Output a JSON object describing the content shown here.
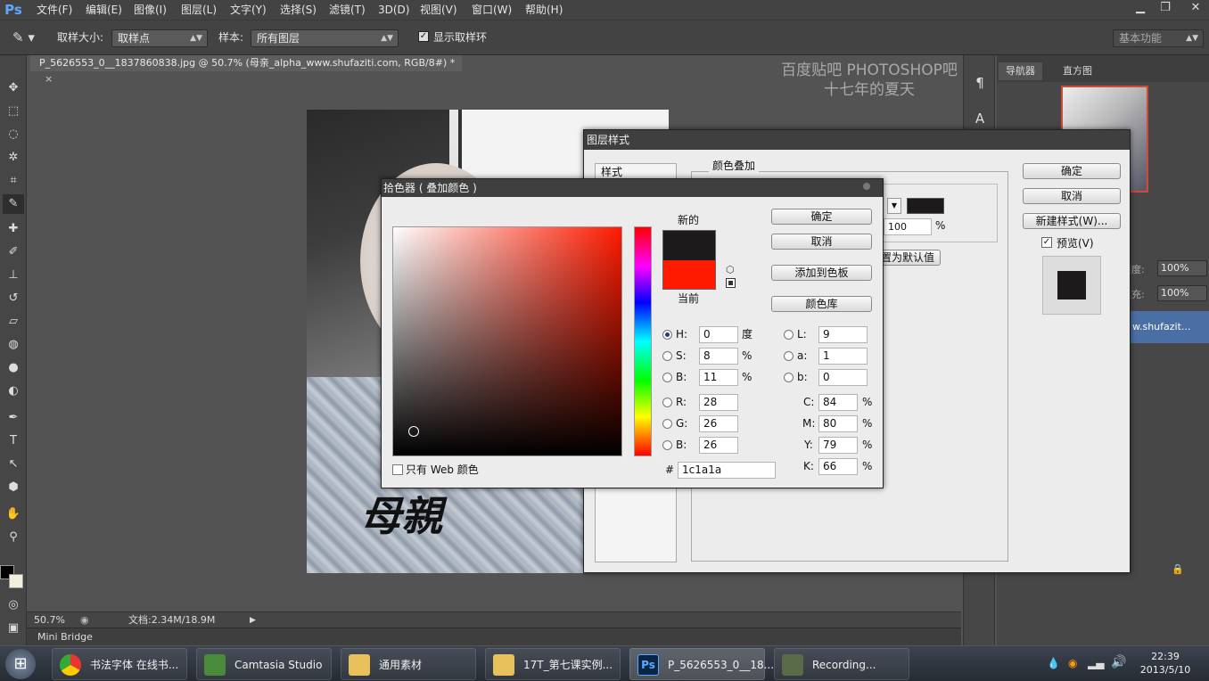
{
  "menubar": {
    "logo": "Ps",
    "items": [
      "文件(F)",
      "编辑(E)",
      "图像(I)",
      "图层(L)",
      "文字(Y)",
      "选择(S)",
      "滤镜(T)",
      "3D(D)",
      "视图(V)",
      "窗口(W)",
      "帮助(H)"
    ],
    "min": "▁",
    "restore": "❐",
    "close": "✕"
  },
  "options": {
    "sample_size_label": "取样大小:",
    "sample_size_value": "取样点",
    "sample_label": "样本:",
    "sample_value": "所有图层",
    "show_ring_label": "显示取样环",
    "workspace": "基本功能"
  },
  "document": {
    "tab_title": "P_5626553_0__1837860838.jpg @ 50.7% (母亲_alpha_www.shufaziti.com, RGB/8#) *",
    "close": "×",
    "calligraphy": "母親"
  },
  "watermark": {
    "line1": "百度贴吧 PHOTOSHOP吧",
    "line2": "十七年的夏天"
  },
  "right_panel": {
    "tab_navigator": "导航器",
    "tab_histogram": "直方图",
    "opacity_label": "明度:",
    "opacity_value": "100%",
    "fill_label": "填充:",
    "fill_value": "100%",
    "layer_name": "w.shufazit..."
  },
  "layer_style": {
    "title": "图层样式",
    "styles_header": "样式",
    "section_title": "颜色叠加",
    "section_sub": "颜色",
    "opacity_value": "100",
    "percent": "%",
    "set_default": "设置为默认值",
    "ok": "确定",
    "cancel": "取消",
    "new_style": "新建样式(W)...",
    "preview": "预览(V)",
    "swatch_color": "#1c1a1a"
  },
  "color_picker": {
    "title": "拾色器 ( 叠加颜色 )",
    "new_label": "新的",
    "current_label": "当前",
    "new_color": "#1c1a1a",
    "current_color": "#ff1a00",
    "ok": "确定",
    "cancel": "取消",
    "add_swatch": "添加到色板",
    "color_libraries": "颜色库",
    "web_only": "只有 Web 颜色",
    "H": {
      "label": "H:",
      "value": "0",
      "unit": "度"
    },
    "S": {
      "label": "S:",
      "value": "8",
      "unit": "%"
    },
    "Bv": {
      "label": "B:",
      "value": "11",
      "unit": "%"
    },
    "R": {
      "label": "R:",
      "value": "28"
    },
    "G": {
      "label": "G:",
      "value": "26"
    },
    "Bc": {
      "label": "B:",
      "value": "26"
    },
    "L": {
      "label": "L:",
      "value": "9"
    },
    "a": {
      "label": "a:",
      "value": "1"
    },
    "b": {
      "label": "b:",
      "value": "0"
    },
    "C": {
      "label": "C:",
      "value": "84",
      "unit": "%"
    },
    "M": {
      "label": "M:",
      "value": "80",
      "unit": "%"
    },
    "Y": {
      "label": "Y:",
      "value": "79",
      "unit": "%"
    },
    "K": {
      "label": "K:",
      "value": "66",
      "unit": "%"
    },
    "hex_label": "#",
    "hex": "1c1a1a"
  },
  "status": {
    "zoom": "50.7%",
    "doc": "文档:2.34M/18.9M"
  },
  "mini_bridge": "Mini Bridge",
  "taskbar": {
    "items": [
      "书法字体 在线书...",
      "Camtasia Studio ...",
      "通用素材",
      "17T_第七课实例...",
      "P_5626553_0__18...",
      "Recording..."
    ],
    "time": "22:39",
    "date": "2013/5/10"
  }
}
